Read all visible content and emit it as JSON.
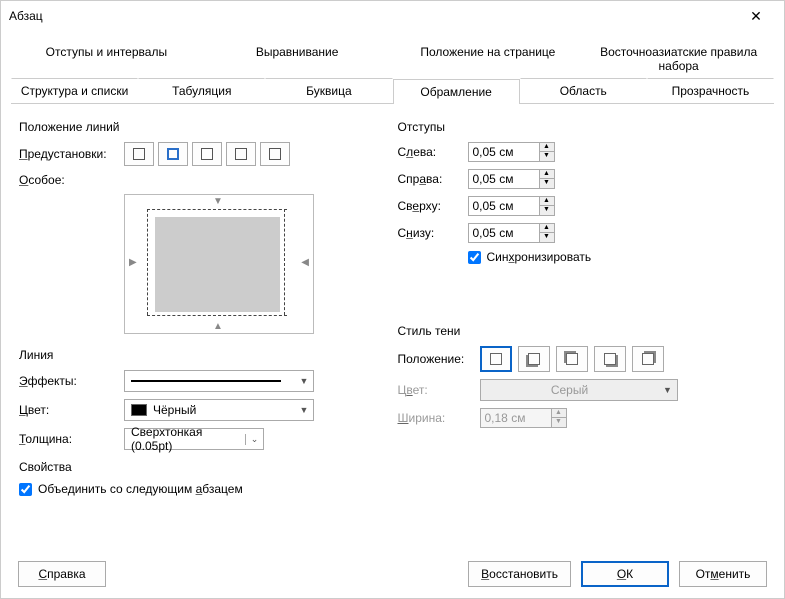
{
  "title": "Абзац",
  "tabs_row1": [
    "Отступы и интервалы",
    "Выравнивание",
    "Положение на странице",
    "Восточноазиатские правила набора"
  ],
  "tabs_row2": [
    "Структура и списки",
    "Табуляция",
    "Буквица",
    "Обрамление",
    "Область",
    "Прозрачность"
  ],
  "active_tab": "Обрамление",
  "left": {
    "lines_head": "Положение линий",
    "presets_label": "Предустановки:",
    "special_label": "Особое:",
    "line_head": "Линия",
    "effects_label": "Эффекты:",
    "color_label": "Цвет:",
    "color_value": "Чёрный",
    "width_label": "Толщина:",
    "width_value": "Сверхтонкая (0.05pt)"
  },
  "right": {
    "padding_head": "Отступы",
    "left_label": "Слева:",
    "left_val": "0,05 см",
    "right_label": "Справа:",
    "right_val": "0,05 см",
    "top_label": "Сверху:",
    "top_val": "0,05 см",
    "bottom_label": "Снизу:",
    "bottom_val": "0,05 см",
    "sync_label": "Синхронизировать",
    "shadow_head": "Стиль тени",
    "position_label": "Положение:",
    "color_label": "Цвет:",
    "color_value": "Серый",
    "width_label": "Ширина:",
    "width_val": "0,18 см"
  },
  "props": {
    "head": "Свойства",
    "merge_label": "Объединить со следующим абзацем"
  },
  "buttons": {
    "help": "Справка",
    "reset": "Восстановить",
    "ok": "ОК",
    "cancel": "Отменить"
  }
}
